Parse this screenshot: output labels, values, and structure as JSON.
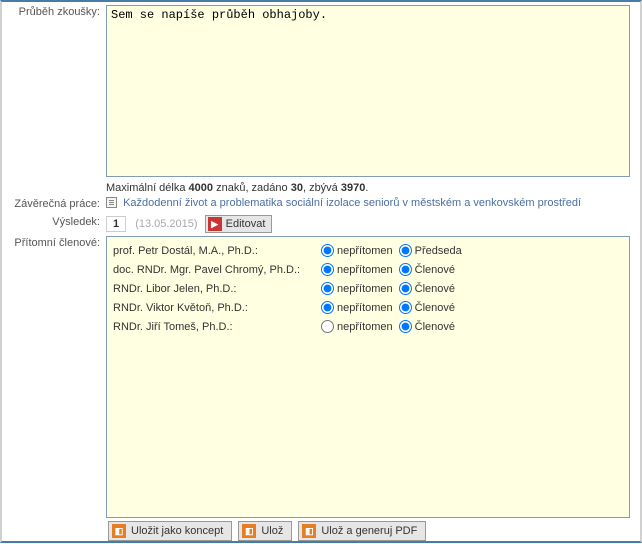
{
  "labels": {
    "prubeh": "Průběh zkoušky:",
    "zaverecna": "Závěrečná práce:",
    "vysledek": "Výsledek:",
    "pritomni": "Přítomní členové:"
  },
  "prubeh": {
    "text": "Sem se napíše průběh obhajoby.",
    "counter_prefix": "Maximální délka ",
    "max": "4000",
    "counter_mid1": " znaků, zadáno ",
    "entered": "30",
    "counter_mid2": ", zbývá ",
    "remaining": "3970",
    "counter_end": "."
  },
  "thesis": {
    "link": "Každodenní život a problematika sociální izolace seniorů v městském a venkovském prostředí"
  },
  "result": {
    "value": "1",
    "date": "(13.05.2015)",
    "edit_label": "Editovat",
    "edit_glyph": "▶"
  },
  "members_labels": {
    "nepritomen": "nepřítomen",
    "predseda": "Předseda",
    "clenove": "Členové"
  },
  "members": [
    {
      "name": "prof. Petr Dostál, M.A., Ph.D.:",
      "att": "nep",
      "role": "pred"
    },
    {
      "name": "doc. RNDr. Mgr. Pavel Chromý, Ph.D.:",
      "att": "nep",
      "role": "clen"
    },
    {
      "name": "RNDr. Libor Jelen, Ph.D.:",
      "att": "nep",
      "role": "clen"
    },
    {
      "name": "RNDr. Viktor Květoň, Ph.D.:",
      "att": "nep",
      "role": "clen"
    },
    {
      "name": "RNDr. Jiří Tomeš, Ph.D.:",
      "att": "none",
      "role": "clen"
    }
  ],
  "buttons": {
    "koncept": "Uložit jako koncept",
    "uloz": "Ulož",
    "ulozpdf": "Ulož a generuj PDF",
    "disk_glyph": "◧"
  }
}
